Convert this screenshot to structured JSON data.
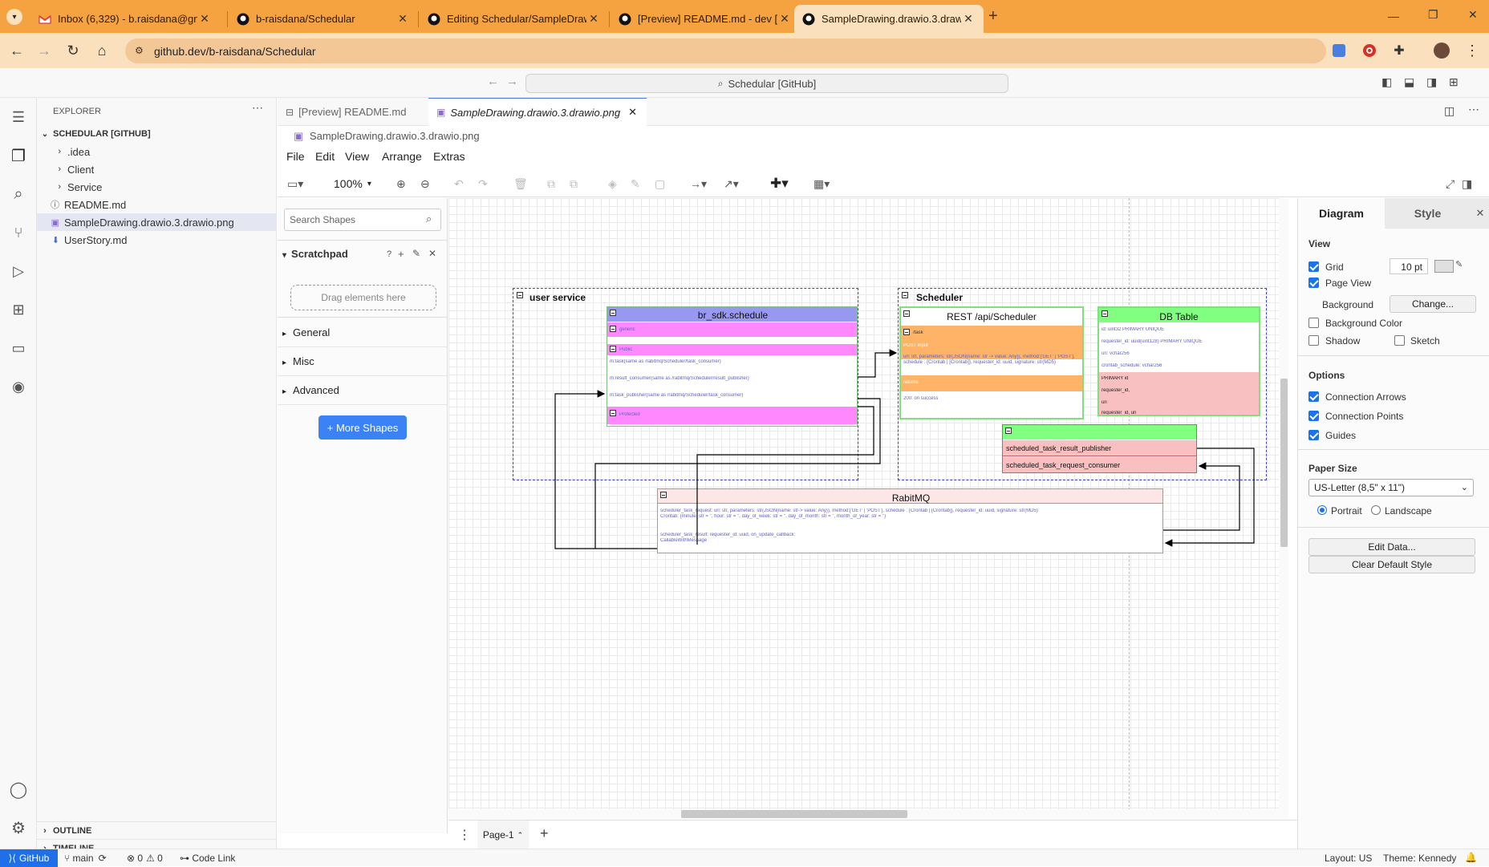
{
  "browser": {
    "tabs": [
      {
        "label": "Inbox (6,329) - b.raisdana@gm",
        "icon": "gmail-icon"
      },
      {
        "label": "b-raisdana/Schedular",
        "icon": "github-icon"
      },
      {
        "label": "Editing Schedular/SampleDraw",
        "icon": "github-icon"
      },
      {
        "label": "[Preview] README.md - dev [G",
        "icon": "github-icon"
      },
      {
        "label": "SampleDrawing.drawio.3.drawi",
        "icon": "github-icon"
      }
    ],
    "new_tab": "+",
    "url": "github.dev/b-raisdana/Schedular"
  },
  "vscode": {
    "command_center": "Schedular [GitHub]",
    "explorer": {
      "title": "EXPLORER",
      "root": "SCHEDULAR [GITHUB]",
      "items": [
        {
          "label": ".idea",
          "type": "folder"
        },
        {
          "label": "Client",
          "type": "folder"
        },
        {
          "label": "Service",
          "type": "folder"
        },
        {
          "label": "README.md",
          "type": "info-file"
        },
        {
          "label": "SampleDrawing.drawio.3.drawio.png",
          "type": "image-file"
        },
        {
          "label": "UserStory.md",
          "type": "md-file"
        }
      ],
      "outline": "OUTLINE",
      "timeline": "TIMELINE"
    },
    "editor_tabs": [
      {
        "label": "[Preview] README.md"
      },
      {
        "label": "SampleDrawing.drawio.3.drawio.png"
      }
    ],
    "breadcrumb": "SampleDrawing.drawio.3.drawio.png"
  },
  "drawio": {
    "menus": [
      "File",
      "Edit",
      "View",
      "Arrange",
      "Extras"
    ],
    "zoom": "100%",
    "search_placeholder": "Search Shapes",
    "scratchpad": {
      "title": "Scratchpad",
      "help": "?",
      "drop_hint": "Drag elements here"
    },
    "libraries": [
      "General",
      "Misc",
      "Advanced"
    ],
    "more_shapes": "+ More Shapes",
    "diagram": {
      "user_service": "user service",
      "scheduler": "Scheduler",
      "br_sdk": {
        "title": "br_sdk.schedule",
        "sec1": "generic",
        "sec2": "Public",
        "lines": [
          "m:task(same as /rabitmq/Scheduler/task_consumer)",
          "m:result_consumer(same as /rabitmq/Scheduler/result_publisher)",
          "m:task_publisher(same as /rabitmq/Scheduler/task_consumer)"
        ],
        "sec3": "Protected"
      },
      "rest": {
        "title": "REST /api/Scheduler",
        "sec1": "/task",
        "sec2": "POST input",
        "body": "uri: str, parameters: str(JSON{name: str -> value: Any}), method:['GET' | 'POST'], schedule : {Crontab | [Crontab]}, requester_id: uuid, signature: str(MD5)",
        "sec3": "returns",
        "ret": "200: on success"
      },
      "db": {
        "title": "DB Table",
        "lines": [
          "id: uint32 PRIMARY UNIQUE",
          "requester_id: uuid(uint128) PRIMARY UNIQUE",
          "uri: vchar256",
          "crontab_schedule: vchar256"
        ],
        "red_lines": [
          "PRIMARY id",
          "requester_id,",
          "uri",
          "requester_id, uri"
        ]
      },
      "queues": [
        "scheduled_task_result_publisher",
        "scheduled_task_request_consumer"
      ],
      "rabbit": {
        "title": "RabitMQ",
        "line1": "scheduler_task_request: uri: str, parameters: str(JSON{name: str-> value: Any}), method:['GET' | 'POST'], schedule : {Crontab | [Crontab]}, requester_id: uuid, signature: str(MD5)",
        "line2": "Crontab: {minute: str = '', hour: str = '', day_of_week: str = '', day_of_month: str = '', month_of_year: str = ''}",
        "line3": "scheduler_task_result: requester_id: uuid, on_update_callback:",
        "line4": "CallableWithMessage"
      }
    },
    "format": {
      "tab_diagram": "Diagram",
      "tab_style": "Style",
      "view_title": "View",
      "grid": "Grid",
      "grid_size": "10 pt",
      "page_view": "Page View",
      "background": "Background",
      "change": "Change...",
      "background_color": "Background Color",
      "shadow": "Shadow",
      "sketch": "Sketch",
      "options_title": "Options",
      "connection_arrows": "Connection Arrows",
      "connection_points": "Connection Points",
      "guides": "Guides",
      "paper_size_title": "Paper Size",
      "paper_size": "US-Letter (8,5\" x 11\")",
      "portrait": "Portrait",
      "landscape": "Landscape",
      "edit_data": "Edit Data...",
      "clear_style": "Clear Default Style"
    },
    "page": "Page-1"
  },
  "status": {
    "remote": "GitHub",
    "branch": "main",
    "errors": "0",
    "warnings": "0",
    "code_link": "Code Link",
    "layout": "Layout: US",
    "theme": "Theme: Kennedy"
  },
  "colors": {
    "accent_tabbar": "#f5a340",
    "uml_magenta": "#ff88ff",
    "uml_orange": "#ffb366",
    "uml_green": "#80ff80",
    "uml_red": "#f8c0c0",
    "uml_blue_header": "#9898f0"
  }
}
